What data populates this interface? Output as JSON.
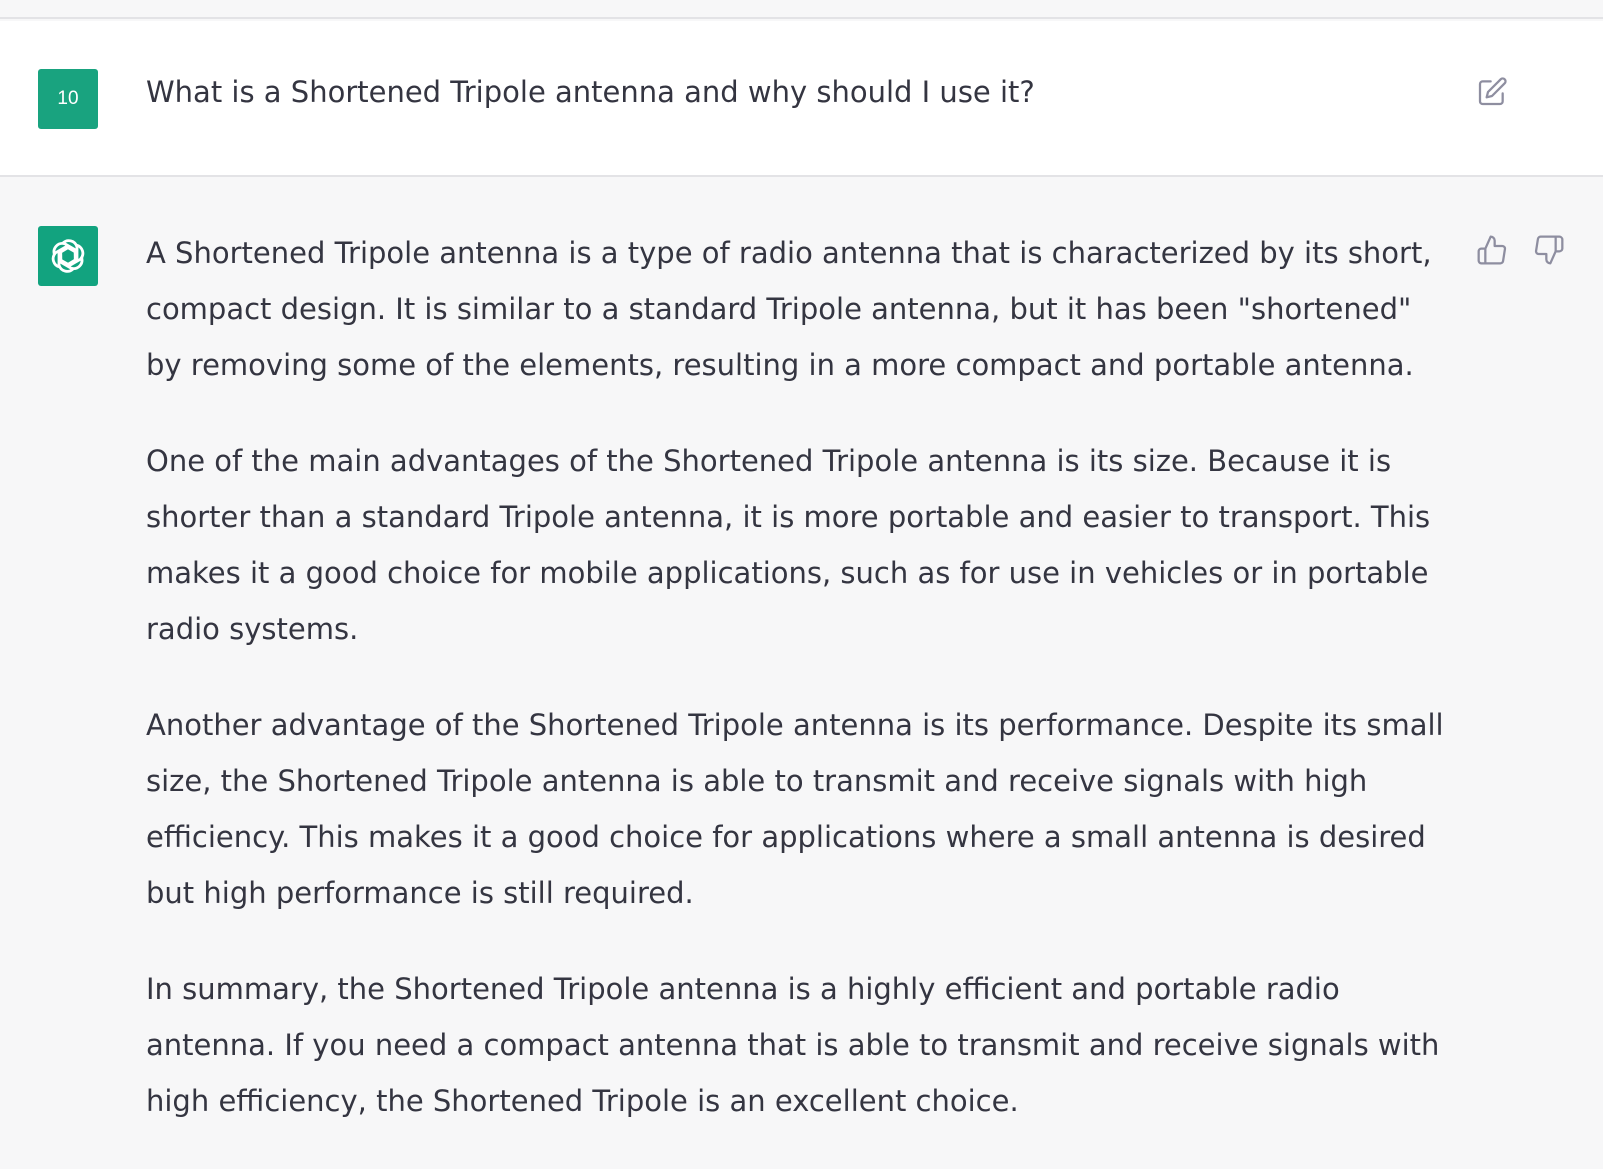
{
  "user_message": {
    "avatar_text": "10",
    "text": "What is a Shortened Tripole antenna and why should I use it?",
    "edit_icon": "edit-icon"
  },
  "assistant_message": {
    "avatar_icon": "openai-logo-icon",
    "paragraphs": [
      "A Shortened Tripole antenna is a type of radio antenna that is characterized by its short, compact design. It is similar to a standard Tripole antenna, but it has been \"shortened\" by removing some of the elements, resulting in a more compact and portable antenna.",
      "One of the main advantages of the Shortened Tripole antenna is its size. Because it is shorter than a standard Tripole antenna, it is more portable and easier to transport. This makes it a good choice for mobile applications, such as for use in vehicles or in portable radio systems.",
      "Another advantage of the Shortened Tripole antenna is its performance. Despite its small size, the Shortened Tripole antenna is able to transmit and receive signals with high efficiency. This makes it a good choice for applications where a small antenna is desired but high performance is still required.",
      "In summary, the Shortened Tripole antenna is a highly efficient and portable radio antenna. If you need a compact antenna that is able to transmit and receive signals with high efficiency, the Shortened Tripole is an excellent choice."
    ],
    "feedback_icons": [
      "thumbs-up-icon",
      "thumbs-down-icon"
    ]
  },
  "colors": {
    "accent": "#19a37f",
    "text": "#343541",
    "user_bg": "#ffffff",
    "assistant_bg": "#f7f7f8",
    "icon": "#8e8ea0"
  }
}
